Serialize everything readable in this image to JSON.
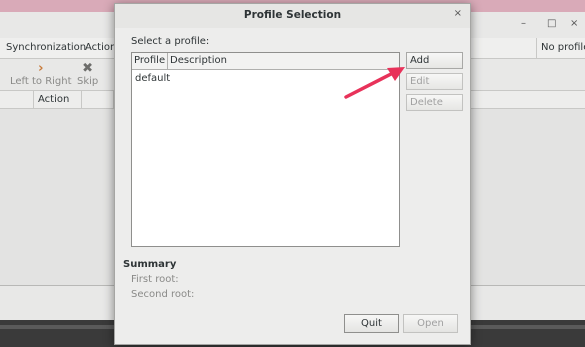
{
  "main_window": {
    "controls": {
      "minimize": "–",
      "maximize": "□",
      "close": "×"
    },
    "menu": [
      "Synchronization",
      "Action"
    ],
    "profile_indicator": "No profile",
    "toolbar": [
      {
        "label": "Left to Right",
        "icon": "chevron-right-icon",
        "glyph": "›"
      },
      {
        "label": "Skip",
        "icon": "x-icon",
        "glyph": "✖"
      }
    ],
    "list_columns": [
      "Action"
    ]
  },
  "dialog": {
    "title": "Profile Selection",
    "close": "×",
    "prompt": "Select a profile:",
    "table": {
      "columns": [
        "Profile",
        "Description"
      ],
      "rows": [
        {
          "profile": "default",
          "description": ""
        }
      ]
    },
    "buttons": {
      "add": "Add",
      "edit": "Edit",
      "delete": "Delete"
    },
    "annotation_arrow_color": "#e8325a",
    "summary": {
      "title": "Summary",
      "first_root_label": "First root:",
      "second_root_label": "Second root:"
    },
    "footer": {
      "quit": "Quit",
      "open": "Open"
    }
  }
}
